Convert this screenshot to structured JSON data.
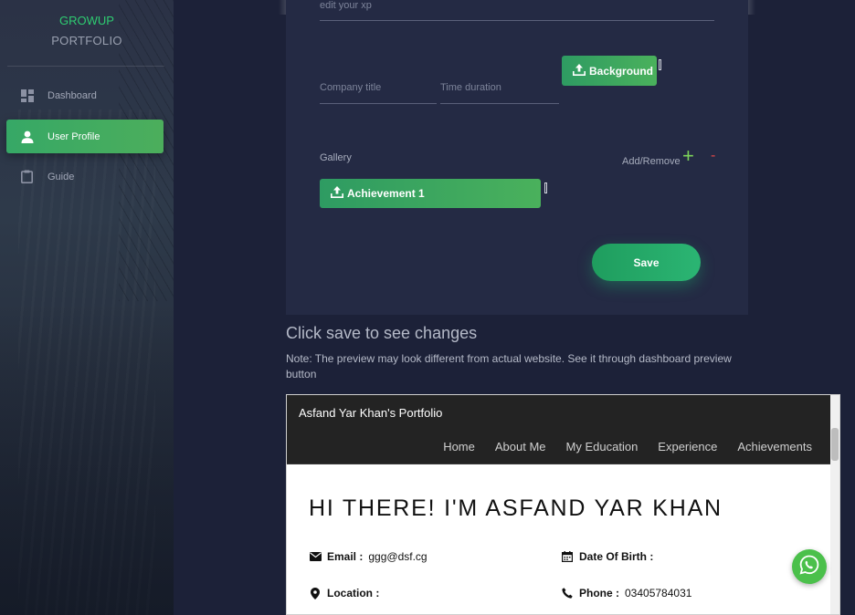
{
  "sidebar": {
    "brand_line1": "GROWUP",
    "brand_line2": "PORTFOLIO",
    "items": [
      {
        "label": "Dashboard",
        "icon": "dashboard-icon",
        "active": false
      },
      {
        "label": "User Profile",
        "icon": "person-icon",
        "active": true
      },
      {
        "label": "Guide",
        "icon": "clipboard-icon",
        "active": false
      }
    ]
  },
  "form": {
    "xp_placeholder": "edit your xp",
    "company_placeholder": "Company title",
    "time_placeholder": "Time duration",
    "background_button": "Background",
    "gallery_label": "Gallery",
    "add_remove_label": "Add/Remove",
    "plus_symbol": "+",
    "minus_symbol": "-",
    "achievement_button": "Achievement 1",
    "save_button": "Save"
  },
  "hint": {
    "title": "Click save to see changes",
    "note": "Note: The preview may look different from actual website. See it through dashboard preview button"
  },
  "preview": {
    "site_title": "Asfand Yar Khan's Portfolio",
    "nav": [
      "Home",
      "About Me",
      "My Education",
      "Experience",
      "Achievements"
    ],
    "heading": "HI THERE! I'M ASFAND YAR KHAN",
    "email_label": "Email :",
    "email_value": "ggg@dsf.cg",
    "dob_label": "Date Of Birth :",
    "dob_value": "",
    "location_label": "Location :",
    "location_value": "",
    "phone_label": "Phone :",
    "phone_value": "03405784031"
  },
  "colors": {
    "accent_green": "#2ecc71",
    "active_nav": "#3fab60",
    "background": "#1c2138",
    "card": "#242a44",
    "whatsapp": "#4bc04b",
    "remove_red": "#e04848"
  }
}
